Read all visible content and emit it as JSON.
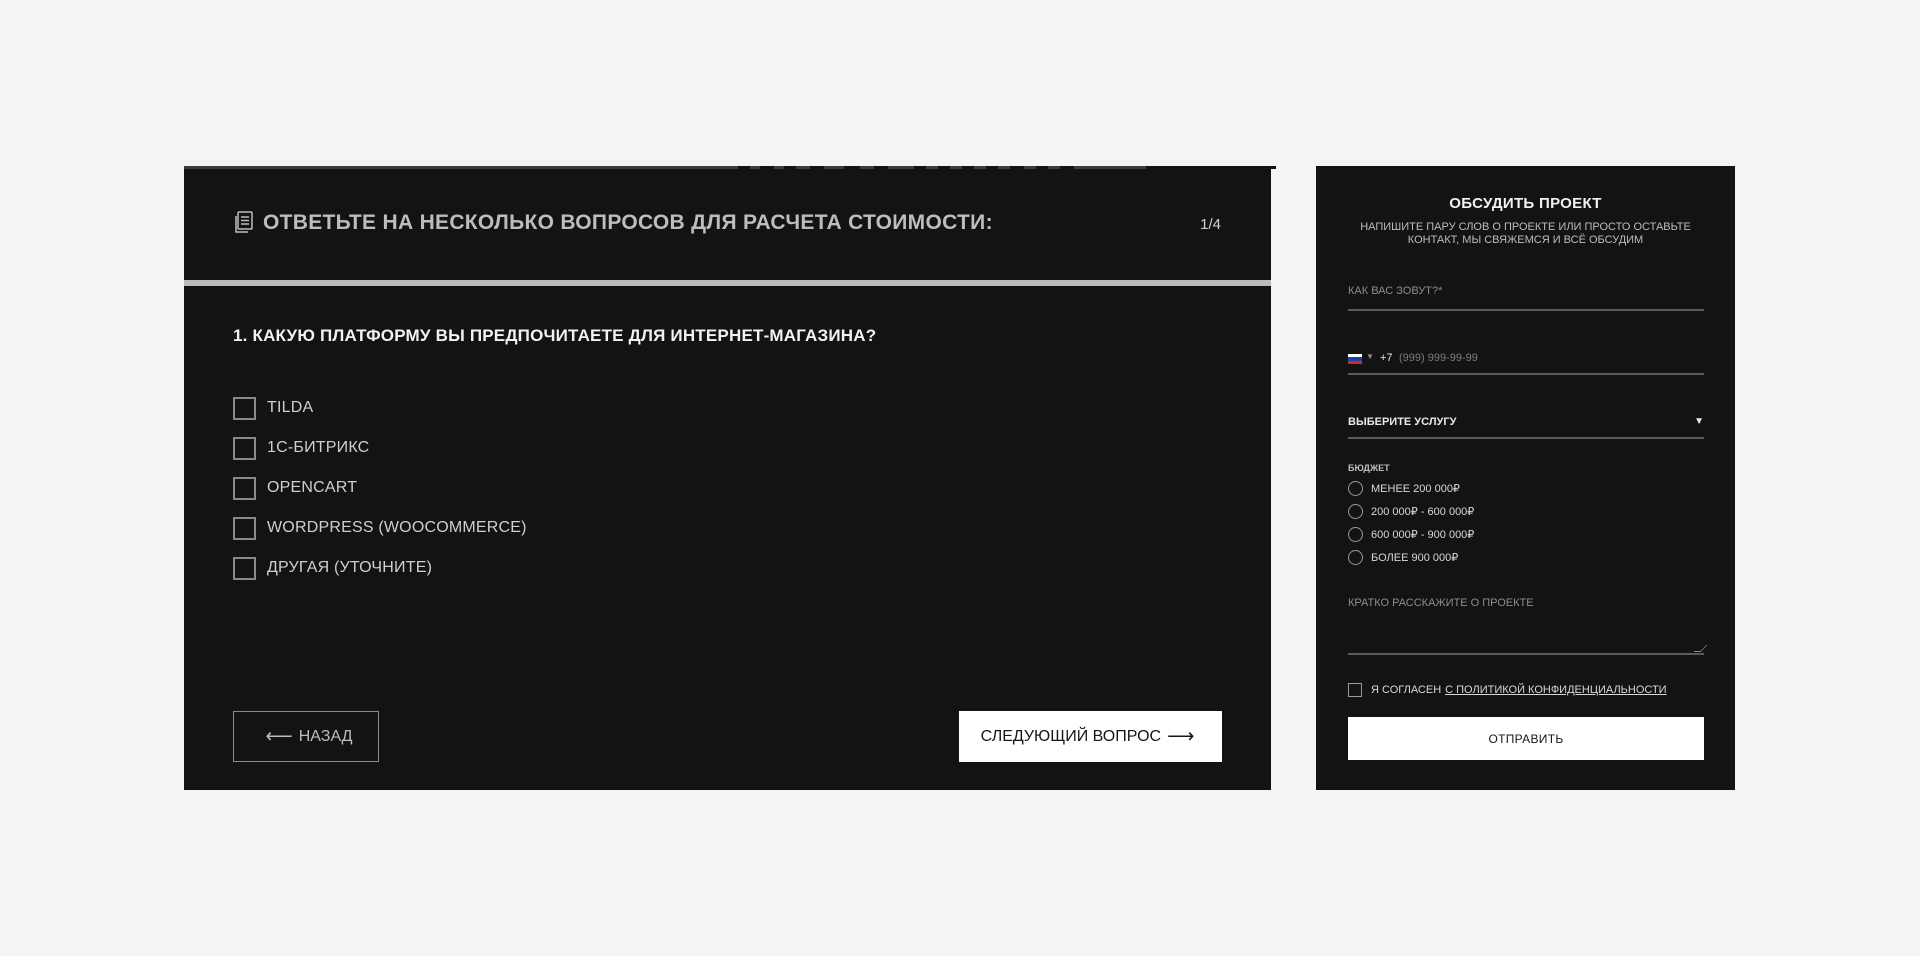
{
  "quiz": {
    "title": "ОТВЕТЬТЕ НА НЕСКОЛЬКО ВОПРОСОВ ДЛЯ РАСЧЕТА СТОИМОСТИ:",
    "counter": "1/4",
    "question": "1. КАКУЮ ПЛАТФОРМУ ВЫ ПРЕДПОЧИТАЕТЕ ДЛЯ ИНТЕРНЕТ-МАГАЗИНА?",
    "options": [
      {
        "label": "TILDA"
      },
      {
        "label": "1С-БИТРИКС"
      },
      {
        "label": "OPENCART"
      },
      {
        "label": "WORDPRESS (WOOCOMMERCE)"
      },
      {
        "label": "ДРУГАЯ (УТОЧНИТЕ)"
      }
    ],
    "back_arrow": "⟵",
    "back_label": "НАЗАД",
    "next_label": "СЛЕДУЮЩИЙ ВОПРОС",
    "next_arrow": "⟶"
  },
  "form": {
    "title": "ОБСУДИТЬ ПРОЕКТ",
    "subtitle": "НАПИШИТЕ ПАРУ СЛОВ О ПРОЕКТЕ ИЛИ ПРОСТО ОСТАВЬТЕ КОНТАКТ, МЫ СВЯЖЕМСЯ И ВСЁ ОБСУДИМ",
    "name_placeholder": "КАК ВАС ЗОВУТ?*",
    "phone_code": "+7",
    "phone_placeholder": "(999) 999-99-99",
    "service_label": "ВЫБЕРИТЕ УСЛУГУ",
    "budget_label": "БЮДЖЕТ",
    "budget_options": [
      {
        "label": "МЕНЕЕ 200 000₽"
      },
      {
        "label": "200 000₽ - 600 000₽"
      },
      {
        "label": "600 000₽ - 900 000₽"
      },
      {
        "label": "БОЛЕЕ 900 000₽"
      }
    ],
    "about_placeholder": "КРАТКО РАССКАЖИТЕ О ПРОЕКТЕ",
    "consent_text": "Я СОГЛАСЕН",
    "consent_link": "С ПОЛИТИКОЙ КОНФИДЕНЦИАЛЬНОСТИ",
    "submit_label": "ОТПРАВИТЬ"
  },
  "colors": {
    "page_bg": "#f4f4f4",
    "panel_bg": "#131313",
    "button_bg": "#ffffff"
  }
}
